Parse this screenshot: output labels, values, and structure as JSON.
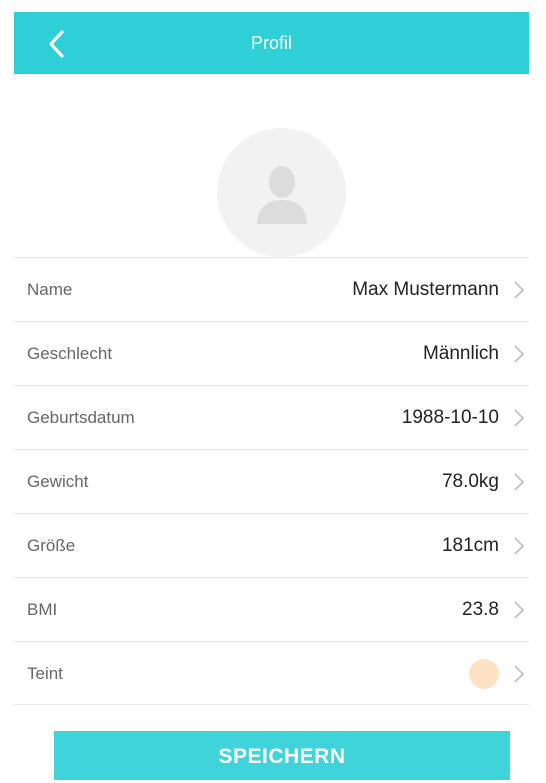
{
  "colors": {
    "accent": "#2ecfd6",
    "button": "#3fd3da",
    "teint_swatch": "#fde3c3"
  },
  "header": {
    "title": "Profil",
    "back_icon": "chevron-left-icon"
  },
  "avatar": {
    "icon": "user-silhouette-icon"
  },
  "fields": [
    {
      "label": "Name",
      "value": "Max Mustermann"
    },
    {
      "label": "Geschlecht",
      "value": "Männlich"
    },
    {
      "label": "Geburtsdatum",
      "value": "1988-10-10"
    },
    {
      "label": "Gewicht",
      "value": "78.0kg"
    },
    {
      "label": "Größe",
      "value": "181cm"
    },
    {
      "label": "BMI",
      "value": "23.8"
    },
    {
      "label": "Teint",
      "value_icon": "color-swatch"
    }
  ],
  "save_button": {
    "label": "SPEICHERN"
  }
}
